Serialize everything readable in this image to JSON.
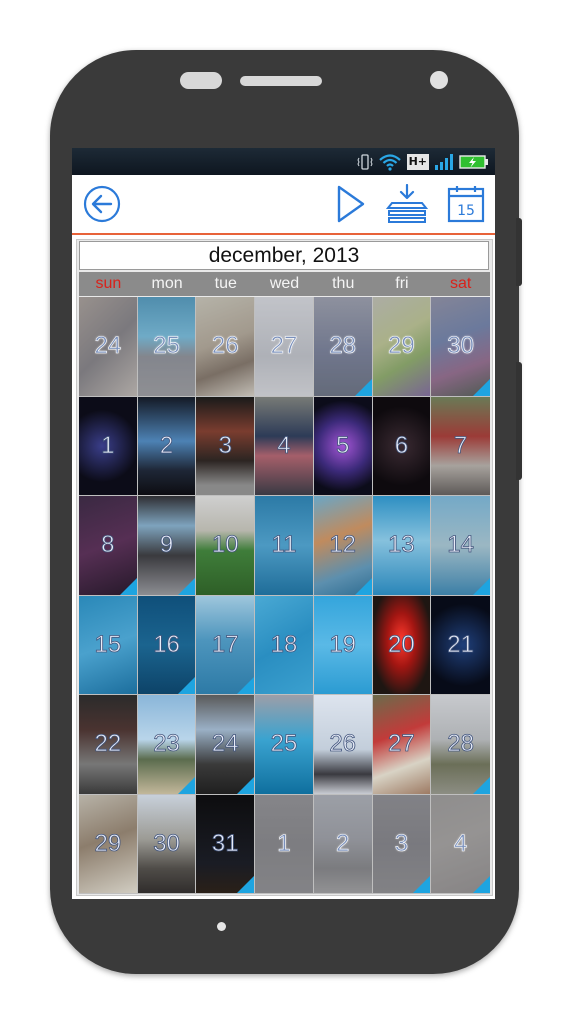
{
  "calendar": {
    "title": "december, 2013",
    "weekdays": [
      "sun",
      "mon",
      "tue",
      "wed",
      "thu",
      "fri",
      "sat"
    ],
    "days": [
      {
        "label": "24",
        "current": false,
        "corner": false,
        "bg": "linear-gradient(135deg,#9a8f86,#6d6a6e 50%,#b9b1a8)"
      },
      {
        "label": "25",
        "current": false,
        "corner": false,
        "bg": "linear-gradient(180deg,#2c8ab7 0%,#5bb6de 40%,#7a7e86 60%,#8b8c90 100%)"
      },
      {
        "label": "26",
        "current": false,
        "corner": false,
        "bg": "linear-gradient(160deg,#c7c3b0,#a99c86 45%,#6b5a48 70%,#d9d2c2)"
      },
      {
        "label": "27",
        "current": false,
        "corner": false,
        "bg": "linear-gradient(180deg,#dadde2,#bcc0c7 60%,#d9dbdf)"
      },
      {
        "label": "28",
        "current": false,
        "corner": true,
        "bg": "linear-gradient(180deg,#8a8fa0,#5d6786 55%,#4a5468)"
      },
      {
        "label": "29",
        "current": false,
        "corner": false,
        "bg": "linear-gradient(150deg,#b8baa9,#b5c07f 40%,#79a04a 65%,#6a4c8f)"
      },
      {
        "label": "30",
        "current": false,
        "corner": true,
        "bg": "linear-gradient(160deg,#7b7d96,#556b9d 40%,#814e78 70%,#2b3c2d)"
      },
      {
        "label": "1",
        "current": true,
        "corner": false,
        "bg": "radial-gradient(circle at 40% 50%,#3a3e8a,#0c0c18 60%)"
      },
      {
        "label": "2",
        "current": true,
        "corner": false,
        "bg": "linear-gradient(180deg,#141a26,#4d82b4 45%,#1e2636 75%,#0d0d12)"
      },
      {
        "label": "3",
        "current": true,
        "corner": false,
        "bg": "linear-gradient(180deg,#1a1a1a,#7a3d2f 35%,#2c2522 65%,#888 90%)"
      },
      {
        "label": "4",
        "current": true,
        "corner": false,
        "bg": "linear-gradient(180deg,#777a76,#2d3b57 40%,#a55f6a 60%,#3a3a44)"
      },
      {
        "label": "5",
        "current": true,
        "corner": false,
        "bg": "radial-gradient(circle at 50% 50%,#a355d4,#3c2a7a 45%,#0c0c1a 80%)"
      },
      {
        "label": "6",
        "current": true,
        "corner": false,
        "bg": "radial-gradient(circle at 50% 50%,#3a2a32,#0e0a0e 70%)"
      },
      {
        "label": "7",
        "current": true,
        "corner": false,
        "bg": "linear-gradient(180deg,#6a7a56,#9b3b37 40%,#a7a29d 70%,#5e5a58)"
      },
      {
        "label": "8",
        "current": true,
        "corner": true,
        "bg": "linear-gradient(160deg,#3a2942,#562f54 50%,#26192a)"
      },
      {
        "label": "9",
        "current": true,
        "corner": true,
        "bg": "linear-gradient(180deg,#2f2f33,#7ea3bd 30%,#3a3a3e 60%,#8c8d92)"
      },
      {
        "label": "10",
        "current": true,
        "corner": false,
        "bg": "linear-gradient(180deg,#cfcfcf,#b7b6ad 35%,#3f7d3a 55%,#2e5f27)"
      },
      {
        "label": "11",
        "current": true,
        "corner": false,
        "bg": "linear-gradient(180deg,#2c7aa6,#4c99c2 50%,#1f6d99)"
      },
      {
        "label": "12",
        "current": true,
        "corner": true,
        "bg": "linear-gradient(160deg,#6aa6c6,#c08b5e 40%,#5c8fae 75%,#2f6d92)"
      },
      {
        "label": "13",
        "current": true,
        "corner": false,
        "bg": "linear-gradient(180deg,#2e8fc2,#86c1dd 45%,#2a86b9)"
      },
      {
        "label": "14",
        "current": true,
        "corner": true,
        "bg": "linear-gradient(180deg,#74a9c7,#9bb7c3 50%,#3c7fa6)"
      },
      {
        "label": "15",
        "current": true,
        "corner": false,
        "bg": "linear-gradient(160deg,#2a88b8,#4aa1cd 50%,#1c6e9d)"
      },
      {
        "label": "16",
        "current": true,
        "corner": true,
        "bg": "linear-gradient(180deg,#0f4f7a,#1b648f 50%,#0d4368)"
      },
      {
        "label": "17",
        "current": true,
        "corner": true,
        "bg": "linear-gradient(180deg,#9ec6dc,#4d95bd 45%,#2d7aa6)"
      },
      {
        "label": "18",
        "current": true,
        "corner": false,
        "bg": "linear-gradient(150deg,#4aa9d4,#2a8ec1 50%,#3ba0cf)"
      },
      {
        "label": "19",
        "current": true,
        "corner": false,
        "bg": "linear-gradient(180deg,#34a5dc,#5ab9e6 50%,#2b9bd2)"
      },
      {
        "label": "20",
        "current": true,
        "corner": false,
        "bg": "radial-gradient(ellipse at 50% 45%,#ff3a2e,#a31612 35%,#1e1612 75%)"
      },
      {
        "label": "21",
        "current": true,
        "corner": false,
        "bg": "radial-gradient(circle at 55% 50%,#1f3f7a,#070b18 70%)"
      },
      {
        "label": "22",
        "current": true,
        "corner": false,
        "bg": "linear-gradient(180deg,#2b2b2b,#4a3330 35%,#777 70%,#3a3a3a)"
      },
      {
        "label": "23",
        "current": true,
        "corner": true,
        "bg": "linear-gradient(180deg,#8ab6d9,#b9d5ea 45%,#5b6c4e 65%,#c2b79a)"
      },
      {
        "label": "24",
        "current": true,
        "corner": true,
        "bg": "linear-gradient(180deg,#5a5a5a,#9ab0c6 35%,#3a3a3a 70%,#1f1f1f)"
      },
      {
        "label": "25",
        "current": true,
        "corner": false,
        "bg": "linear-gradient(180deg,#9c9ea8,#3aa3d0 45%,#0f6f9e)"
      },
      {
        "label": "26",
        "current": true,
        "corner": false,
        "bg": "linear-gradient(180deg,#dde4ee,#c3cedb 55%,#3a3a40 80%,#c9ccd3)"
      },
      {
        "label": "27",
        "current": true,
        "corner": false,
        "bg": "linear-gradient(160deg,#6b6b4b,#c23b3a 40%,#d8d3c5 70%,#9d7a63)"
      },
      {
        "label": "28",
        "current": true,
        "corner": true,
        "bg": "linear-gradient(180deg,#c7c9cd,#aeb1b4 45%,#6b6f58 70%,#8c8d83)"
      },
      {
        "label": "29",
        "current": true,
        "corner": false,
        "bg": "linear-gradient(160deg,#b7b2a7,#8c7d6c 45%,#d1cdc2)"
      },
      {
        "label": "30",
        "current": true,
        "corner": false,
        "bg": "linear-gradient(180deg,#c8d0da,#9c9b95 45%,#4f4c48 75%,#302d2c)"
      },
      {
        "label": "31",
        "current": true,
        "corner": true,
        "bg": "linear-gradient(180deg,#0d0d0f,#1a1c24 70%,#2a2018)"
      },
      {
        "label": "1",
        "current": false,
        "corner": false,
        "bg": "linear-gradient(180deg,#7d7d80,#707073 50%,#7a7a7c)"
      },
      {
        "label": "2",
        "current": false,
        "corner": false,
        "bg": "linear-gradient(180deg,#a0a5ad,#8d9097 45%,#6d6e70 75%,#909090)"
      },
      {
        "label": "3",
        "current": false,
        "corner": true,
        "bg": "linear-gradient(180deg,#78787c,#6b6b70 50%,#78787a)"
      },
      {
        "label": "4",
        "current": false,
        "corner": true,
        "bg": "linear-gradient(160deg,#8c8a86,#96938f 45%,#7f7b79)"
      }
    ]
  },
  "actionbar": {
    "back_icon": "back-arrow-icon",
    "play_icon": "play-icon",
    "import_icon": "import-stack-icon",
    "calendar_icon": "calendar-15-icon",
    "calendar_icon_day": "15"
  },
  "status": {
    "network": "H+"
  },
  "colors": {
    "accent": "#2b7ad9",
    "divider": "#e8633a",
    "weekend": "#d9221b",
    "corner_flag": "#1ea4e0"
  }
}
